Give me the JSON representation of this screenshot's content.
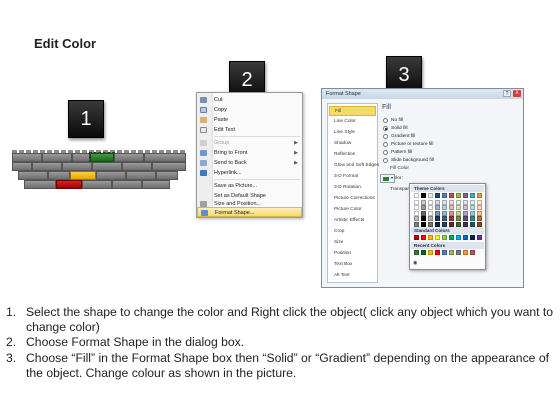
{
  "title": "Edit Color",
  "steps": [
    "1",
    "2",
    "3"
  ],
  "context_menu": {
    "items": [
      {
        "label": "Cut",
        "icon": "scissors-icon"
      },
      {
        "label": "Copy",
        "icon": "copy-icon"
      },
      {
        "label": "Paste",
        "icon": "paste-icon"
      },
      {
        "label": "Edit Text",
        "icon": "edit-text-icon"
      },
      {
        "label": "Group",
        "icon": "group-icon",
        "disabled": true,
        "submenu": true
      },
      {
        "label": "Bring to Front",
        "icon": "bring-front-icon",
        "submenu": true
      },
      {
        "label": "Send to Back",
        "icon": "send-back-icon",
        "submenu": true
      },
      {
        "label": "Hyperlink...",
        "icon": "hyperlink-icon"
      },
      {
        "label": "Save as Picture...",
        "icon": "save-picture-icon"
      },
      {
        "label": "Set as Default Shape",
        "icon": "default-shape-icon"
      },
      {
        "label": "Size and Position...",
        "icon": "size-position-icon"
      },
      {
        "label": "Format Shape...",
        "icon": "format-shape-icon",
        "highlighted": true
      }
    ]
  },
  "dialog": {
    "title": "Format Shape",
    "help": "?",
    "close": "X",
    "categories": [
      "Fill",
      "Line Color",
      "Line Style",
      "Shadow",
      "Reflection",
      "Glow and Soft Edges",
      "3-D Format",
      "3-D Rotation",
      "Picture Corrections",
      "Picture Color",
      "Artistic Effects",
      "Crop",
      "Size",
      "Position",
      "Text Box",
      "Alt Text"
    ],
    "selected_category": "Fill",
    "fill_heading": "Fill",
    "fill_options": [
      "No fill",
      "Solid fill",
      "Gradient fill",
      "Picture or texture fill",
      "Pattern fill",
      "Slide background fill"
    ],
    "selected_fill": "Solid fill",
    "fill_color_label": "Fill Color",
    "color_label": "Color:",
    "transparency_label": "Transpar",
    "current_color": "#2e7d32"
  },
  "palette": {
    "theme_colors_label": "Theme Colors",
    "standard_colors_label": "Standard Colors",
    "recent_colors_label": "Recent Colors",
    "more_icon": "more-colors-icon",
    "theme_row": [
      "#ffffff",
      "#000000",
      "#eeece1",
      "#1f497d",
      "#4f81bd",
      "#c0504d",
      "#9bbb59",
      "#8064a2",
      "#4bacc6",
      "#f79646"
    ],
    "standard_row": [
      "#c00000",
      "#ff0000",
      "#ffc000",
      "#ffff00",
      "#92d050",
      "#00b050",
      "#00b0f0",
      "#0070c0",
      "#002060",
      "#7030a0"
    ],
    "recent_row": [
      "#2e7d32",
      "#1b5e20",
      "#ffc000",
      "#ff0000",
      "#4f81bd",
      "#9bbb59",
      "#7f7f7f",
      "#f79646",
      "#c0504d"
    ]
  },
  "instructions": [
    "Select the shape to change the color and Right click the object( click any object which you want to change color)",
    "Choose Format Shape in the dialog box.",
    "Choose “Fill” in the Format Shape box then “Solid” or “Gradient” depending on the appearance of the object. Change colour as shown in the picture."
  ],
  "instruction_numbers": [
    "1.",
    "2.",
    "3."
  ]
}
